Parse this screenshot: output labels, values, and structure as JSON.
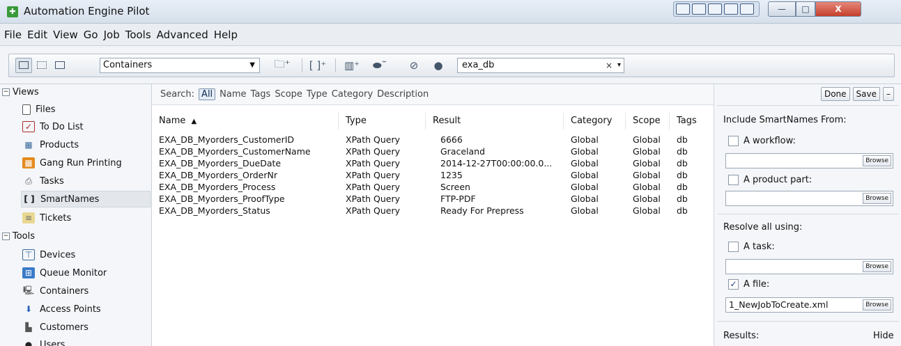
{
  "window": {
    "title": "Automation Engine Pilot",
    "close_label": "X",
    "minimize_label": "—",
    "maximize_label": "□"
  },
  "menu": [
    "File",
    "Edit",
    "View",
    "Go",
    "Job",
    "Tools",
    "Advanced",
    "Help"
  ],
  "toolbar": {
    "container_select": "Containers",
    "search_value": "exa_db",
    "search_clear": "×"
  },
  "nav": {
    "views_label": "Views",
    "views_items": [
      {
        "label": "Files",
        "icon": "file-icon"
      },
      {
        "label": "To Do List",
        "icon": "todo-icon"
      },
      {
        "label": "Products",
        "icon": "products-icon"
      },
      {
        "label": "Gang Run Printing",
        "icon": "gang-run-icon"
      },
      {
        "label": "Tasks",
        "icon": "tasks-icon"
      },
      {
        "label": "SmartNames",
        "icon": "smartnames-icon"
      },
      {
        "label": "Tickets",
        "icon": "tickets-icon"
      }
    ],
    "tools_label": "Tools",
    "tools_items": [
      {
        "label": "Devices",
        "icon": "devices-icon"
      },
      {
        "label": "Queue Monitor",
        "icon": "queue-icon"
      },
      {
        "label": "Containers",
        "icon": "containers-icon"
      },
      {
        "label": "Access Points",
        "icon": "access-points-icon"
      },
      {
        "label": "Customers",
        "icon": "customers-icon"
      },
      {
        "label": "Users",
        "icon": "users-icon"
      }
    ]
  },
  "filter": {
    "search_label": "Search:",
    "options": [
      "All",
      "Name",
      "Tags",
      "Scope",
      "Type",
      "Category",
      "Description"
    ]
  },
  "table": {
    "columns": [
      "Name",
      "Type",
      "Result",
      "Category",
      "Scope",
      "Tags"
    ],
    "rows": [
      [
        "EXA_DB_Myorders_CustomerID",
        "XPath Query",
        "6666",
        "Global",
        "Global",
        "db"
      ],
      [
        "EXA_DB_Myorders_CustomerName",
        "XPath Query",
        "Graceland",
        "Global",
        "Global",
        "db"
      ],
      [
        "EXA_DB_Myorders_DueDate",
        "XPath Query",
        "2014-12-27T00:00:00.0...",
        "Global",
        "Global",
        "db"
      ],
      [
        "EXA_DB_Myorders_OrderNr",
        "XPath Query",
        "1235",
        "Global",
        "Global",
        "db"
      ],
      [
        "EXA_DB_Myorders_Process",
        "XPath Query",
        "Screen",
        "Global",
        "Global",
        "db"
      ],
      [
        "EXA_DB_Myorders_ProofType",
        "XPath Query",
        "FTP-PDF",
        "Global",
        "Global",
        "db"
      ],
      [
        "EXA_DB_Myorders_Status",
        "XPath Query",
        "Ready For Prepress",
        "Global",
        "Global",
        "db"
      ]
    ]
  },
  "rightpanel": {
    "done_label": "Done",
    "save_label": "Save",
    "more_label": "–",
    "include_label": "Include SmartNames From:",
    "workflow_label": "A workflow:",
    "product_part_label": "A product part:",
    "resolve_label": "Resolve all using:",
    "task_label": "A task:",
    "file_label": "A file:",
    "file_value": "1_NewJobToCreate.xml",
    "browse_label": "Browse",
    "results_label": "Results:",
    "hide_label": "Hide"
  },
  "colors": {
    "accent": "#7f93ad",
    "titlebar": "#d6e0ec",
    "close": "#c53f2b"
  }
}
